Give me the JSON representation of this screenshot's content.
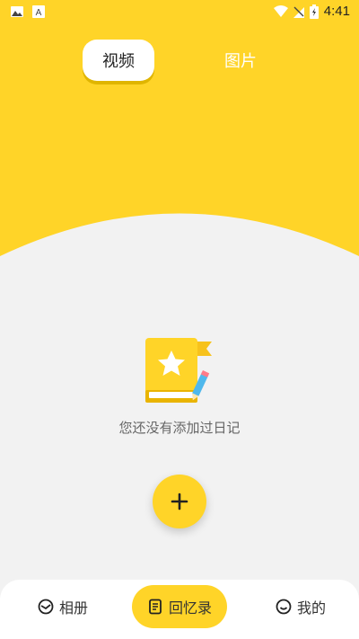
{
  "status_bar": {
    "time": "4:41",
    "icons": [
      "gallery-icon",
      "font-app-icon",
      "wifi-icon",
      "no-signal-icon",
      "battery-charging-icon"
    ]
  },
  "tabs": {
    "video_label": "视频",
    "image_label": "图片",
    "active": "视频"
  },
  "empty_state": {
    "message": "您还没有添加过日记",
    "illustration": "diary-book-star-icon"
  },
  "add_button": {
    "icon": "plus-icon"
  },
  "bottom_nav": {
    "items": [
      {
        "label": "相册",
        "icon": "album-icon"
      },
      {
        "label": "回忆录",
        "icon": "memo-icon",
        "active": true
      },
      {
        "label": "我的",
        "icon": "smile-icon"
      }
    ]
  },
  "colors": {
    "accent": "#ffd428",
    "background": "#f2f2f2"
  }
}
